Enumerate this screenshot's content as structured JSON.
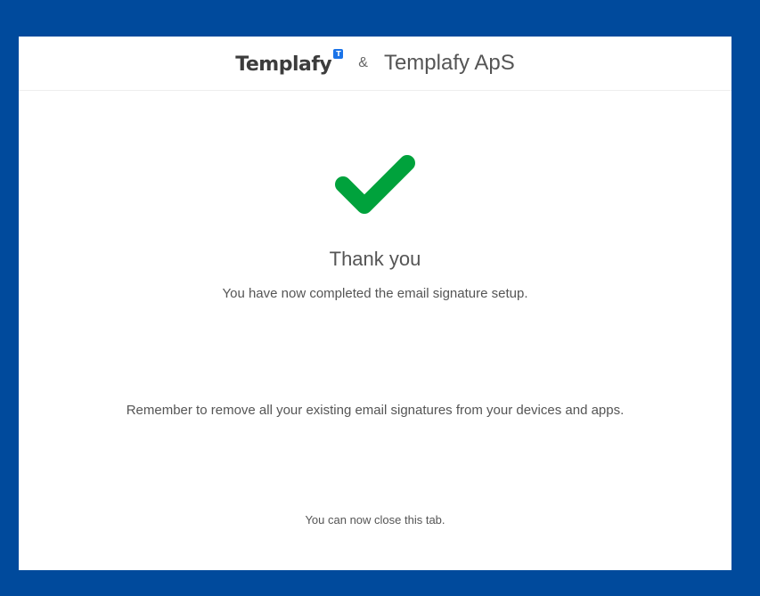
{
  "header": {
    "logo_text": "Templafy",
    "logo_badge": "T",
    "separator": "&",
    "company_name": "Templafy ApS"
  },
  "main": {
    "icon": "checkmark-icon",
    "title": "Thank you",
    "subtitle": "You have now completed the email signature setup.",
    "reminder": "Remember to remove all your existing email signatures from your devices and apps.",
    "close_note": "You can now close this tab."
  },
  "colors": {
    "background": "#004a9c",
    "check": "#00a23c",
    "badge": "#1a73e8"
  }
}
